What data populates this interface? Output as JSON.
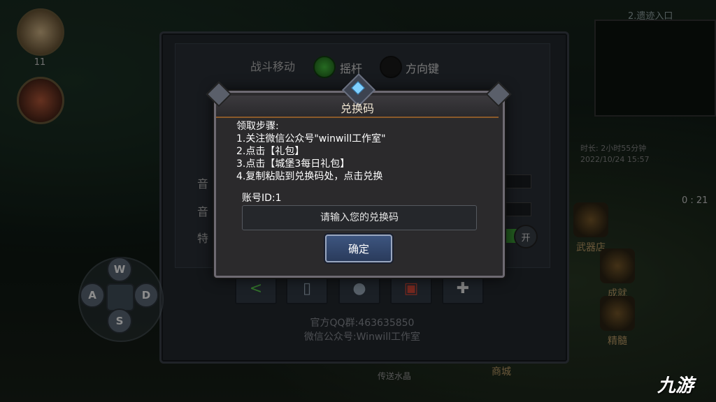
{
  "settings": {
    "battle_move_label": "战斗移动",
    "option_joystick": "摇杆",
    "option_dpad": "方向键",
    "partial_label_1": "音乐",
    "partial_label_2": "音效",
    "partial_label_3": "特效",
    "toggle_on": "开",
    "qq_group": "官方QQ群:463635850",
    "wechat_account": "微信公众号:Winwill工作室"
  },
  "dialog": {
    "title": "兑换码",
    "steps": [
      "领取步骤:",
      "1.关注微信公众号\"winwill工作室\"",
      "2.点击【礼包】",
      "3.点击【城堡3每日礼包】",
      "4.复制粘贴到兑换码处，点击兑换"
    ],
    "account_id": "账号ID:1",
    "code_placeholder": "请输入您的兑换码",
    "confirm_label": "确定"
  },
  "hud": {
    "player_level": "11",
    "minimap_title": "2.遗迹入口",
    "online_time": "时长: 2小时55分钟",
    "date": "2022/10/24 15:57",
    "timer": "0 : 21",
    "shop_weapon": "武器店",
    "achievement": "成就",
    "elite": "精髓",
    "mall": "商城",
    "teleport_crystal": "传送水晶"
  },
  "dpad": {
    "up": "W",
    "left": "A",
    "down": "S",
    "right": "D"
  },
  "watermark": "九游"
}
